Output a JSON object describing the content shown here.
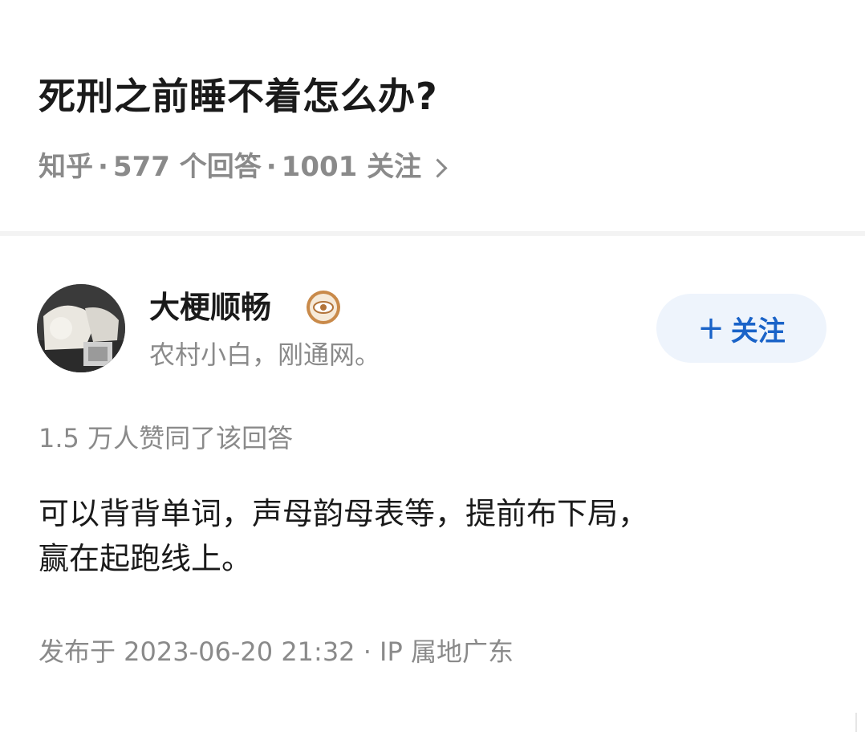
{
  "question": {
    "title": "死刑之前睡不着怎么办?",
    "source": "知乎",
    "answers": "577 个回答",
    "followers": "1001 关注"
  },
  "answer": {
    "author": {
      "name": "大梗顺畅",
      "bio": "农村小白，刚通网。",
      "badge_icon": "eye-badge-icon"
    },
    "follow_button": {
      "plus": "+",
      "label": "关注"
    },
    "votes": "1.5 万人赞同了该回答",
    "content_lines": [
      "可以背背单词，声母韵母表等，提前布下局，",
      "赢在起跑线上。"
    ],
    "publish_info": "发布于 2023-06-20 21:32 · IP 属地广东"
  },
  "colors": {
    "accent": "#1a63c8",
    "follow_bg": "#eef4fc",
    "muted_text": "#8a8a8a",
    "badge": "#c98a4a"
  }
}
